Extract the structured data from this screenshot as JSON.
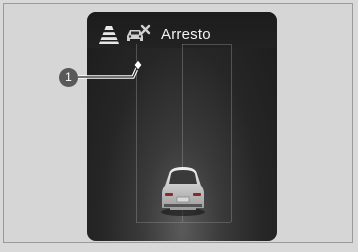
{
  "display": {
    "status_label": "Arresto",
    "icons": [
      "cone-icon",
      "car-warning-icon"
    ],
    "colors": {
      "screen_background": "#1f1f1f",
      "text": "#f2f2f2",
      "callout": "#595959"
    }
  },
  "callout": {
    "number": "1"
  }
}
